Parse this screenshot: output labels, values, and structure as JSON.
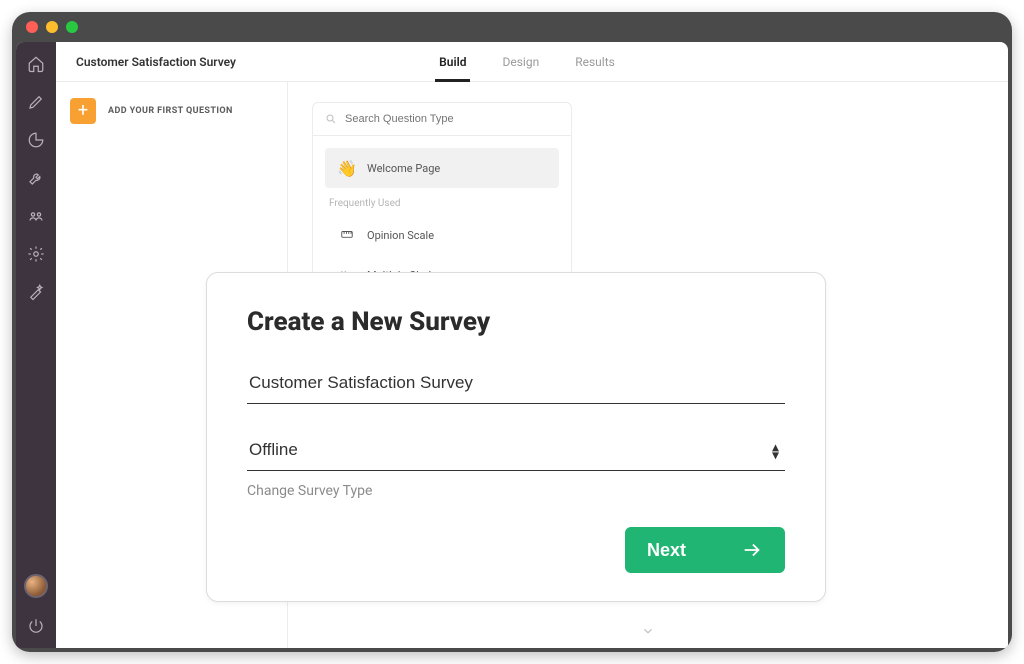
{
  "header": {
    "survey_title": "Customer Satisfaction Survey",
    "tabs": {
      "build": "Build",
      "design": "Design",
      "results": "Results"
    }
  },
  "builder": {
    "add_label": "ADD YOUR FIRST QUESTION"
  },
  "qtype_panel": {
    "search_placeholder": "Search Question Type",
    "welcome_label": "Welcome Page",
    "subhead": "Frequently Used",
    "opinion_scale": "Opinion Scale",
    "multiple_choice": "Multiple Choice"
  },
  "modal": {
    "title": "Create a New Survey",
    "name_value": "Customer Satisfaction Survey",
    "type_value": "Offline",
    "help_text": "Change Survey Type",
    "next_label": "Next"
  }
}
